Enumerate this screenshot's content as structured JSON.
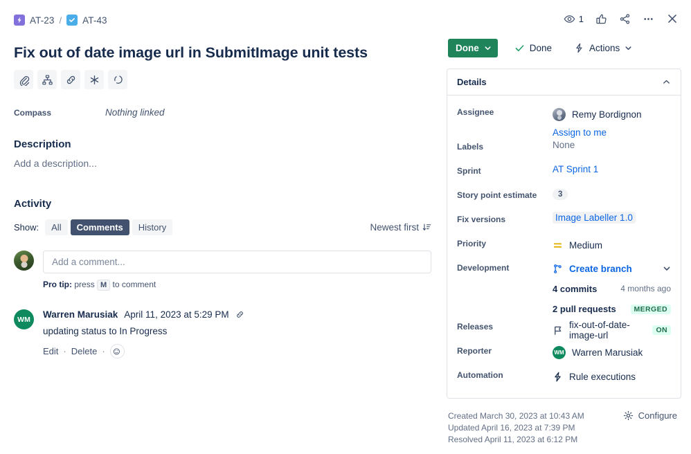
{
  "breadcrumb": {
    "parent": {
      "key": "AT-23",
      "icon": "epic-icon"
    },
    "separator": "/",
    "current": {
      "key": "AT-43",
      "icon": "task-icon"
    }
  },
  "issue": {
    "title": "Fix out of date image url in SubmitImage unit tests"
  },
  "quick_actions": [
    {
      "name": "attach-icon",
      "tooltip": "Attach"
    },
    {
      "name": "child-issue-icon",
      "tooltip": "Add a child issue"
    },
    {
      "name": "link-issue-icon",
      "tooltip": "Link issue"
    },
    {
      "name": "apps-icon",
      "tooltip": "Apps"
    },
    {
      "name": "loop-icon",
      "tooltip": "Loop"
    }
  ],
  "compass": {
    "label": "Compass",
    "value": "Nothing linked"
  },
  "description": {
    "heading": "Description",
    "placeholder": "Add a description..."
  },
  "activity": {
    "heading": "Activity",
    "show_label": "Show:",
    "tabs": [
      {
        "label": "All",
        "active": false
      },
      {
        "label": "Comments",
        "active": true
      },
      {
        "label": "History",
        "active": false
      }
    ],
    "sort": "Newest first",
    "comment_placeholder": "Add a comment...",
    "pro_tip_prefix": "Pro tip:",
    "pro_tip_press": "press",
    "pro_tip_key": "M",
    "pro_tip_suffix": "to comment",
    "comments": [
      {
        "initials": "WM",
        "author": "Warren Marusiak",
        "date": "April 11, 2023 at 5:29 PM",
        "body": "updating status to In Progress",
        "actions": {
          "edit": "Edit",
          "delete": "Delete",
          "separator": "·"
        }
      }
    ]
  },
  "top_actions": {
    "watch_count": "1",
    "icons": [
      "watch-icon",
      "like-icon",
      "share-icon",
      "more-icon",
      "close-icon"
    ]
  },
  "toolbar": {
    "status": "Done",
    "done_action": "Done",
    "actions": "Actions"
  },
  "details": {
    "title": "Details",
    "fields": {
      "assignee": {
        "label": "Assignee",
        "value": "Remy Bordignon",
        "assign_to_me": "Assign to me"
      },
      "labels": {
        "label": "Labels",
        "value": "None"
      },
      "sprint": {
        "label": "Sprint",
        "value": "AT Sprint 1"
      },
      "story_points": {
        "label": "Story point estimate",
        "value": "3"
      },
      "fix_versions": {
        "label": "Fix versions",
        "value": "Image Labeller 1.0"
      },
      "priority": {
        "label": "Priority",
        "value": "Medium",
        "icon": "priority-medium-icon"
      },
      "development": {
        "label": "Development",
        "create_branch": "Create branch",
        "commits": "4 commits",
        "commits_time": "4 months ago",
        "pull_requests": "2 pull requests",
        "pr_status": "MERGED"
      },
      "releases": {
        "label": "Releases",
        "value": "fix-out-of-date-image-url",
        "status": "ON"
      },
      "reporter": {
        "label": "Reporter",
        "value": "Warren Marusiak",
        "initials": "WM"
      },
      "automation": {
        "label": "Automation",
        "value": "Rule executions"
      }
    }
  },
  "footer": {
    "created": "Created March 30, 2023 at 10:43 AM",
    "updated": "Updated April 16, 2023 at 7:39 PM",
    "resolved": "Resolved April 11, 2023 at 6:12 PM",
    "configure": "Configure"
  },
  "colors": {
    "status_green": "#1f845a",
    "link_blue": "#0c66e4",
    "text_primary": "#172b4d",
    "text_subtle": "#44546f",
    "epic_purple": "#8270db",
    "task_blue": "#4bade8",
    "avatar_green": "#0f8a5f",
    "priority_orange": "#e2b203",
    "lozenge_green_bg": "#dcfff1",
    "lozenge_green_text": "#216e4e"
  }
}
